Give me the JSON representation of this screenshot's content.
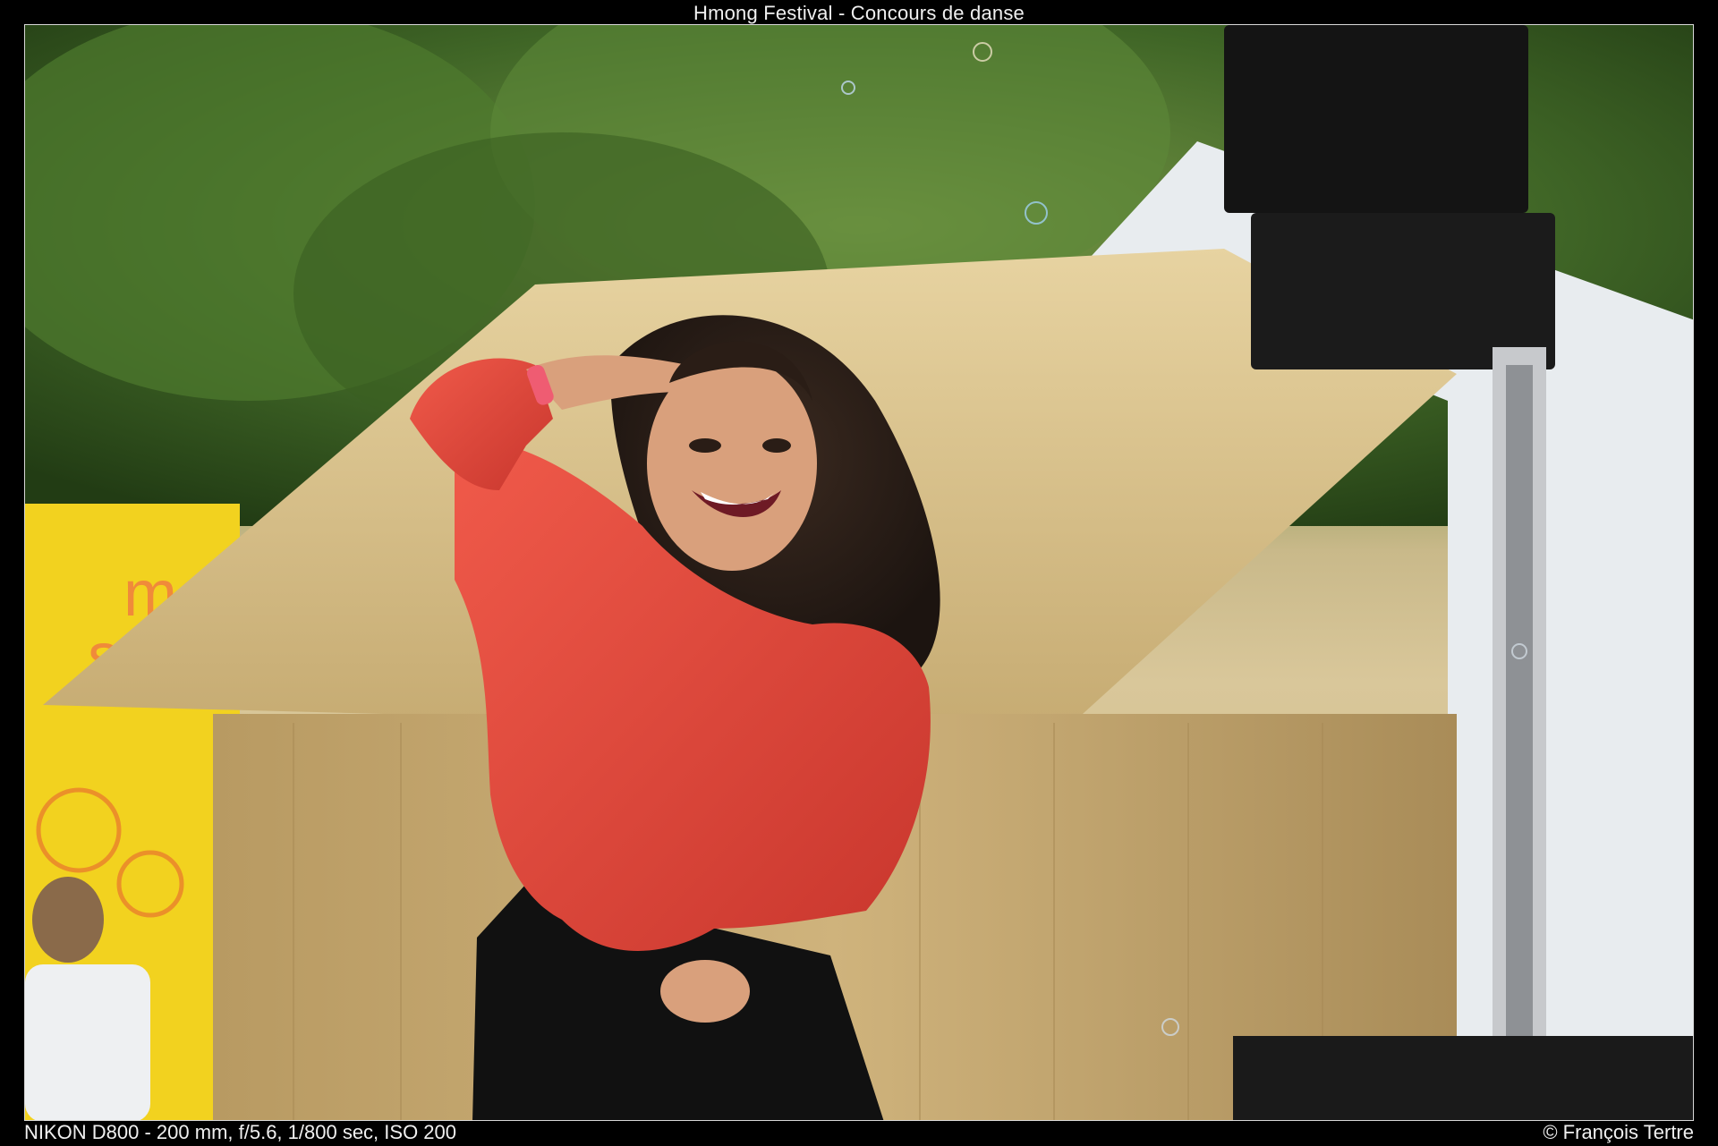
{
  "title": "Hmong Festival - Concours de danse",
  "exif": "NIKON D800 - 200 mm, f/5.6, 1/800 sec, ISO 200",
  "copyright": "© François Tertre",
  "banner_text": [
    "moo",
    "sti"
  ],
  "colors": {
    "frame_border": "#d8d8d8",
    "sweater": "#e0463b",
    "banner": "#f2d21f",
    "thatch": "#d8c08a"
  }
}
